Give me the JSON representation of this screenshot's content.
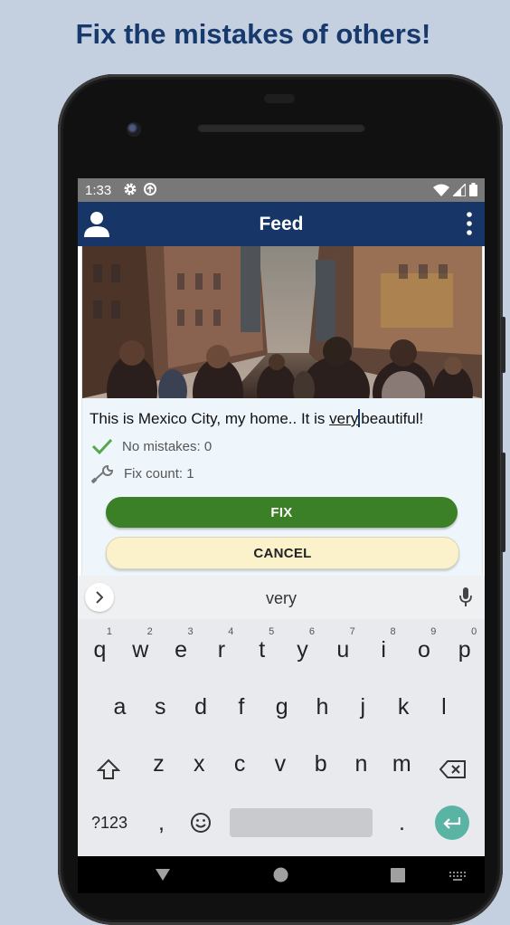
{
  "promo": {
    "title": "Fix the mistakes of others!"
  },
  "status_bar": {
    "time": "1:33"
  },
  "app_bar": {
    "title": "Feed"
  },
  "post": {
    "text_before": "This is Mexico City, my home.. It is ",
    "selected_word": "very",
    "text_after": "beautiful!",
    "no_mistakes_label": "No mistakes: 0",
    "fix_count_label": "Fix count: 1"
  },
  "buttons": {
    "fix": "FIX",
    "cancel": "CANCEL"
  },
  "keyboard": {
    "suggestion": "very",
    "row1": [
      {
        "k": "q",
        "h": "1"
      },
      {
        "k": "w",
        "h": "2"
      },
      {
        "k": "e",
        "h": "3"
      },
      {
        "k": "r",
        "h": "4"
      },
      {
        "k": "t",
        "h": "5"
      },
      {
        "k": "y",
        "h": "6"
      },
      {
        "k": "u",
        "h": "7"
      },
      {
        "k": "i",
        "h": "8"
      },
      {
        "k": "o",
        "h": "9"
      },
      {
        "k": "p",
        "h": "0"
      }
    ],
    "row2": [
      "a",
      "s",
      "d",
      "f",
      "g",
      "h",
      "j",
      "k",
      "l"
    ],
    "row3": [
      "z",
      "x",
      "c",
      "v",
      "b",
      "n",
      "m"
    ],
    "symbols_key": "?123",
    "comma_key": ",",
    "period_key": "."
  },
  "colors": {
    "app_bar": "#173566",
    "fix_button": "#3b7f27",
    "cancel_button": "#fbf2cc",
    "enter_key": "#5ab4a4"
  }
}
